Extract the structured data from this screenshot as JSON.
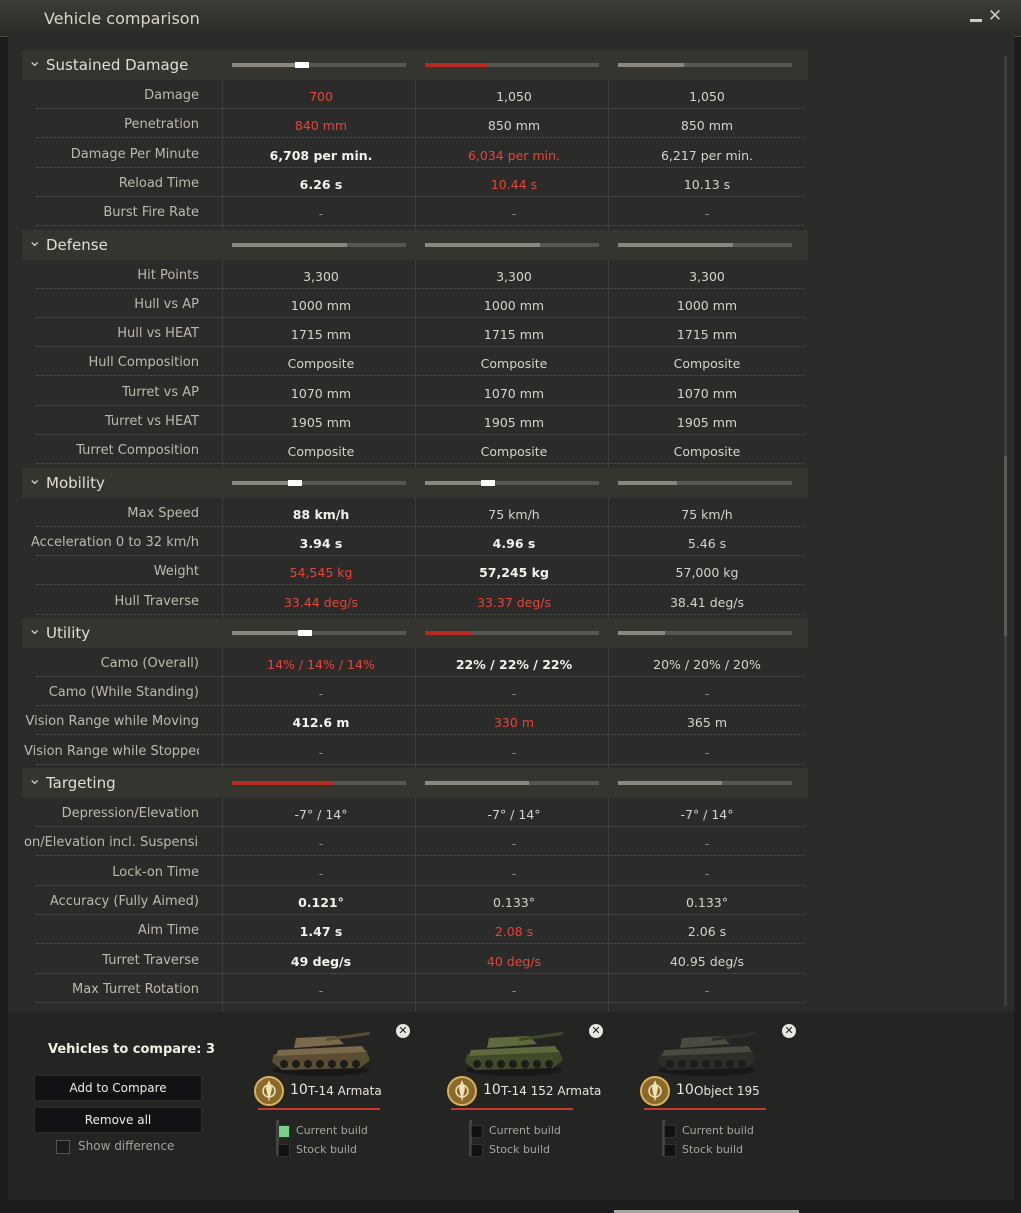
{
  "window": {
    "title": "Vehicle comparison",
    "minimize_icon": "minimize-icon",
    "close_icon": "close-icon",
    "close_glyph": "✕"
  },
  "rows": [
    {
      "type": "category",
      "name": "Sustained Damage",
      "bars": [
        {
          "fill": 0.38,
          "mark": 0.38
        },
        {
          "fill": 0.36,
          "red": true
        },
        {
          "fill": 0.38
        }
      ]
    },
    {
      "type": "stat",
      "label": "Damage",
      "values": [
        {
          "v": "700",
          "s": "worse"
        },
        {
          "v": "1,050",
          "s": "normal"
        },
        {
          "v": "1,050",
          "s": "normal"
        }
      ]
    },
    {
      "type": "stat",
      "label": "Penetration",
      "values": [
        {
          "v": "840 mm",
          "s": "worse"
        },
        {
          "v": "850 mm",
          "s": "normal"
        },
        {
          "v": "850 mm",
          "s": "normal"
        }
      ]
    },
    {
      "type": "stat",
      "label": "Damage Per Minute",
      "values": [
        {
          "v": "6,708 per min.",
          "s": "best"
        },
        {
          "v": "6,034 per min.",
          "s": "worse"
        },
        {
          "v": "6,217 per min.",
          "s": "normal"
        }
      ]
    },
    {
      "type": "stat",
      "label": "Reload Time",
      "values": [
        {
          "v": "6.26 s",
          "s": "best"
        },
        {
          "v": "10.44 s",
          "s": "worse"
        },
        {
          "v": "10.13 s",
          "s": "normal"
        }
      ]
    },
    {
      "type": "stat",
      "label": "Burst Fire Rate",
      "values": [
        {
          "v": "-",
          "s": "dash"
        },
        {
          "v": "-",
          "s": "dash"
        },
        {
          "v": "-",
          "s": "dash"
        }
      ]
    },
    {
      "type": "category",
      "name": "Defense",
      "bars": [
        {
          "fill": 0.66
        },
        {
          "fill": 0.66
        },
        {
          "fill": 0.66
        }
      ]
    },
    {
      "type": "stat",
      "label": "Hit Points",
      "values": [
        {
          "v": "3,300",
          "s": "normal"
        },
        {
          "v": "3,300",
          "s": "normal"
        },
        {
          "v": "3,300",
          "s": "normal"
        }
      ]
    },
    {
      "type": "stat",
      "label": "Hull vs AP",
      "values": [
        {
          "v": "1000 mm",
          "s": "normal"
        },
        {
          "v": "1000 mm",
          "s": "normal"
        },
        {
          "v": "1000 mm",
          "s": "normal"
        }
      ]
    },
    {
      "type": "stat",
      "label": "Hull vs HEAT",
      "values": [
        {
          "v": "1715 mm",
          "s": "normal"
        },
        {
          "v": "1715 mm",
          "s": "normal"
        },
        {
          "v": "1715 mm",
          "s": "normal"
        }
      ]
    },
    {
      "type": "stat",
      "label": "Hull Composition",
      "values": [
        {
          "v": "Composite",
          "s": "normal"
        },
        {
          "v": "Composite",
          "s": "normal"
        },
        {
          "v": "Composite",
          "s": "normal"
        }
      ]
    },
    {
      "type": "stat",
      "label": "Turret vs AP",
      "values": [
        {
          "v": "1070 mm",
          "s": "normal"
        },
        {
          "v": "1070 mm",
          "s": "normal"
        },
        {
          "v": "1070 mm",
          "s": "normal"
        }
      ]
    },
    {
      "type": "stat",
      "label": "Turret vs HEAT",
      "values": [
        {
          "v": "1905 mm",
          "s": "normal"
        },
        {
          "v": "1905 mm",
          "s": "normal"
        },
        {
          "v": "1905 mm",
          "s": "normal"
        }
      ]
    },
    {
      "type": "stat",
      "label": "Turret Composition",
      "values": [
        {
          "v": "Composite",
          "s": "normal"
        },
        {
          "v": "Composite",
          "s": "normal"
        },
        {
          "v": "Composite",
          "s": "normal"
        }
      ]
    },
    {
      "type": "category",
      "name": "Mobility",
      "bars": [
        {
          "fill": 0.34,
          "mark": 0.34
        },
        {
          "fill": 0.34,
          "mark": 0.34
        },
        {
          "fill": 0.34
        }
      ]
    },
    {
      "type": "stat",
      "label": "Max Speed",
      "values": [
        {
          "v": "88 km/h",
          "s": "best"
        },
        {
          "v": "75 km/h",
          "s": "normal"
        },
        {
          "v": "75 km/h",
          "s": "normal"
        }
      ]
    },
    {
      "type": "stat",
      "label": "Acceleration 0 to 32 km/h",
      "values": [
        {
          "v": "3.94 s",
          "s": "best"
        },
        {
          "v": "4.96 s",
          "s": "best"
        },
        {
          "v": "5.46 s",
          "s": "normal"
        }
      ]
    },
    {
      "type": "stat",
      "label": "Weight",
      "values": [
        {
          "v": "54,545 kg",
          "s": "worse"
        },
        {
          "v": "57,245 kg",
          "s": "best"
        },
        {
          "v": "57,000 kg",
          "s": "normal"
        }
      ]
    },
    {
      "type": "stat",
      "label": "Hull Traverse",
      "values": [
        {
          "v": "33.44 deg/s",
          "s": "worse"
        },
        {
          "v": "33.37 deg/s",
          "s": "worse"
        },
        {
          "v": "38.41 deg/s",
          "s": "normal"
        }
      ]
    },
    {
      "type": "category",
      "name": "Utility",
      "bars": [
        {
          "fill": 0.4,
          "mark": 0.4
        },
        {
          "fill": 0.27,
          "red": true
        },
        {
          "fill": 0.27
        }
      ]
    },
    {
      "type": "stat",
      "label": "Camo (Overall)",
      "values": [
        {
          "v": "14% / 14% / 14%",
          "s": "worse"
        },
        {
          "v": "22% / 22% / 22%",
          "s": "best"
        },
        {
          "v": "20% / 20% / 20%",
          "s": "normal"
        }
      ]
    },
    {
      "type": "stat",
      "label": "Camo (While Standing)",
      "values": [
        {
          "v": "-",
          "s": "dash"
        },
        {
          "v": "-",
          "s": "dash"
        },
        {
          "v": "-",
          "s": "dash"
        }
      ]
    },
    {
      "type": "stat",
      "label": "Vision Range while Moving",
      "values": [
        {
          "v": "412.6 m",
          "s": "best"
        },
        {
          "v": "330 m",
          "s": "worse"
        },
        {
          "v": "365 m",
          "s": "normal"
        }
      ]
    },
    {
      "type": "stat",
      "label": "Vision Range while Stopped",
      "values": [
        {
          "v": "-",
          "s": "dash"
        },
        {
          "v": "-",
          "s": "dash"
        },
        {
          "v": "-",
          "s": "dash"
        }
      ]
    },
    {
      "type": "category",
      "name": "Targeting",
      "bars": [
        {
          "fill": 0.58,
          "red": true
        },
        {
          "fill": 0.6
        },
        {
          "fill": 0.6
        }
      ]
    },
    {
      "type": "stat",
      "label": "Depression/Elevation",
      "values": [
        {
          "v": "-7° / 14°",
          "s": "normal"
        },
        {
          "v": "-7° / 14°",
          "s": "normal"
        },
        {
          "v": "-7° / 14°",
          "s": "normal"
        }
      ]
    },
    {
      "type": "stat",
      "label": "on/Elevation incl. Suspension",
      "values": [
        {
          "v": "-",
          "s": "dash"
        },
        {
          "v": "-",
          "s": "dash"
        },
        {
          "v": "-",
          "s": "dash"
        }
      ]
    },
    {
      "type": "stat",
      "label": "Lock-on Time",
      "values": [
        {
          "v": "-",
          "s": "dash"
        },
        {
          "v": "-",
          "s": "dash"
        },
        {
          "v": "-",
          "s": "dash"
        }
      ]
    },
    {
      "type": "stat",
      "label": "Accuracy (Fully Aimed)",
      "values": [
        {
          "v": "0.121°",
          "s": "best"
        },
        {
          "v": "0.133°",
          "s": "normal"
        },
        {
          "v": "0.133°",
          "s": "normal"
        }
      ]
    },
    {
      "type": "stat",
      "label": "Aim Time",
      "values": [
        {
          "v": "1.47 s",
          "s": "best"
        },
        {
          "v": "2.08 s",
          "s": "worse"
        },
        {
          "v": "2.06 s",
          "s": "normal"
        }
      ]
    },
    {
      "type": "stat",
      "label": "Turret Traverse",
      "values": [
        {
          "v": "49 deg/s",
          "s": "best"
        },
        {
          "v": "40 deg/s",
          "s": "worse"
        },
        {
          "v": "40.95 deg/s",
          "s": "normal"
        }
      ]
    },
    {
      "type": "stat",
      "label": "Max Turret Rotation",
      "values": [
        {
          "v": "-",
          "s": "dash"
        },
        {
          "v": "-",
          "s": "dash"
        },
        {
          "v": "-",
          "s": "dash"
        }
      ]
    }
  ],
  "footer": {
    "count_label": "Vehicles to compare: 3",
    "add_button": "Add to Compare",
    "remove_button": "Remove all",
    "show_difference": "Show difference"
  },
  "vehicles": [
    {
      "tier": "10",
      "name": "T-14 Armata",
      "current_build": "Current build",
      "stock_build": "Stock build",
      "current_selected": true,
      "camo": "desert"
    },
    {
      "tier": "10",
      "name": "T-14 152 Armata",
      "current_build": "Current build",
      "stock_build": "Stock build",
      "current_selected": false,
      "camo": "green"
    },
    {
      "tier": "10",
      "name": "Object 195",
      "current_build": "Current build",
      "stock_build": "Stock build",
      "current_selected": false,
      "camo": "dark"
    }
  ],
  "colors": {
    "worse": "#e4453a",
    "best": "#f4f2ec",
    "accent_red": "#c7392f",
    "checkbox_on": "#7bcf8a"
  }
}
